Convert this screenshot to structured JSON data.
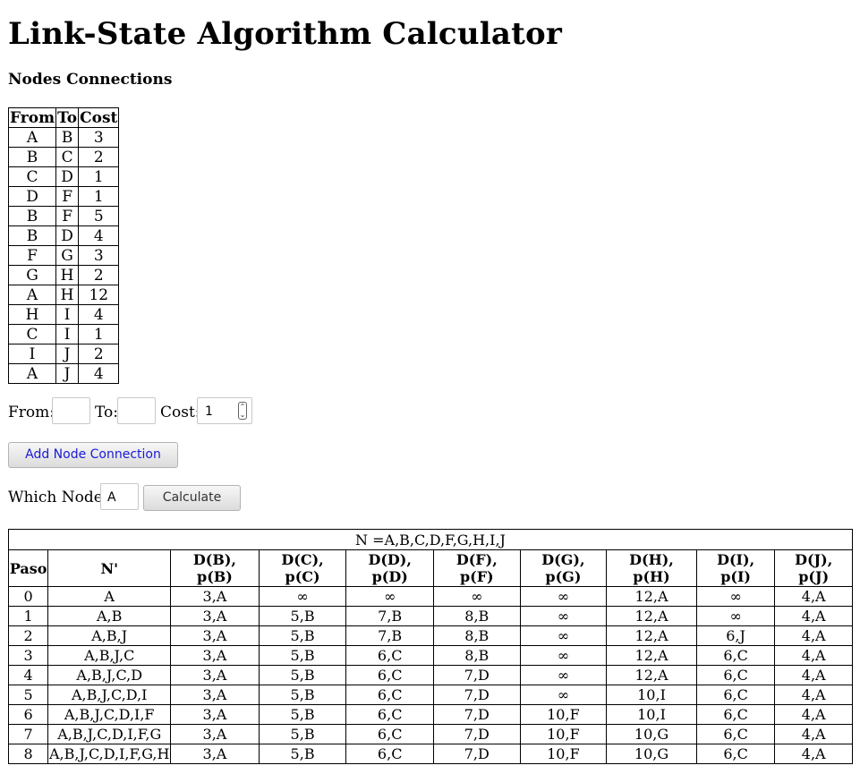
{
  "page": {
    "title": "Link-State Algorithm Calculator",
    "connections_heading": "Nodes Connections"
  },
  "connections_table": {
    "headers": [
      "From",
      "To",
      "Cost"
    ],
    "rows": [
      [
        "A",
        "B",
        "3"
      ],
      [
        "B",
        "C",
        "2"
      ],
      [
        "C",
        "D",
        "1"
      ],
      [
        "D",
        "F",
        "1"
      ],
      [
        "B",
        "F",
        "5"
      ],
      [
        "B",
        "D",
        "4"
      ],
      [
        "F",
        "G",
        "3"
      ],
      [
        "G",
        "H",
        "2"
      ],
      [
        "A",
        "H",
        "12"
      ],
      [
        "H",
        "I",
        "4"
      ],
      [
        "C",
        "I",
        "1"
      ],
      [
        "I",
        "J",
        "2"
      ],
      [
        "A",
        "J",
        "4"
      ]
    ]
  },
  "add_form": {
    "from_label": "From:",
    "from_value": "",
    "to_label": "To:",
    "to_value": "",
    "cost_label": "Cost:",
    "cost_value": "1",
    "add_button": "Add Node Connection"
  },
  "calc_form": {
    "which_node_label": "Which Node:",
    "which_node_value": "A",
    "calculate_button": "Calculate"
  },
  "result_table": {
    "caption": "N =A,B,C,D,F,G,H,I,J",
    "headers": [
      "Paso",
      "N'",
      "D(B), p(B)",
      "D(C), p(C)",
      "D(D), p(D)",
      "D(F), p(F)",
      "D(G), p(G)",
      "D(H), p(H)",
      "D(I), p(I)",
      "D(J), p(J)"
    ],
    "rows": [
      [
        "0",
        "A",
        "3,A",
        "∞",
        "∞",
        "∞",
        "∞",
        "12,A",
        "∞",
        "4,A"
      ],
      [
        "1",
        "A,B",
        "3,A",
        "5,B",
        "7,B",
        "8,B",
        "∞",
        "12,A",
        "∞",
        "4,A"
      ],
      [
        "2",
        "A,B,J",
        "3,A",
        "5,B",
        "7,B",
        "8,B",
        "∞",
        "12,A",
        "6,J",
        "4,A"
      ],
      [
        "3",
        "A,B,J,C",
        "3,A",
        "5,B",
        "6,C",
        "8,B",
        "∞",
        "12,A",
        "6,C",
        "4,A"
      ],
      [
        "4",
        "A,B,J,C,D",
        "3,A",
        "5,B",
        "6,C",
        "7,D",
        "∞",
        "12,A",
        "6,C",
        "4,A"
      ],
      [
        "5",
        "A,B,J,C,D,I",
        "3,A",
        "5,B",
        "6,C",
        "7,D",
        "∞",
        "10,I",
        "6,C",
        "4,A"
      ],
      [
        "6",
        "A,B,J,C,D,I,F",
        "3,A",
        "5,B",
        "6,C",
        "7,D",
        "10,F",
        "10,I",
        "6,C",
        "4,A"
      ],
      [
        "7",
        "A,B,J,C,D,I,F,G",
        "3,A",
        "5,B",
        "6,C",
        "7,D",
        "10,F",
        "10,G",
        "6,C",
        "4,A"
      ],
      [
        "8",
        "A,B,J,C,D,I,F,G,H",
        "3,A",
        "5,B",
        "6,C",
        "7,D",
        "10,F",
        "10,G",
        "6,C",
        "4,A"
      ]
    ]
  }
}
